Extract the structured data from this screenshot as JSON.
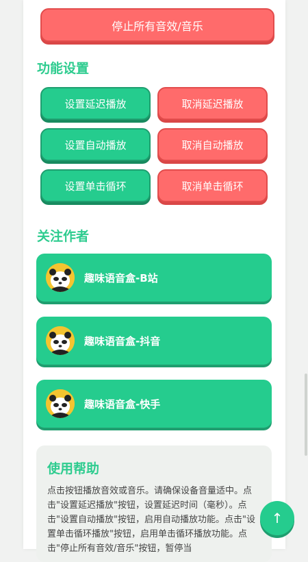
{
  "stop_button": "停止所有音效/音乐",
  "function_section": {
    "title": "功能设置",
    "buttons": [
      "设置延迟播放",
      "取消延迟播放",
      "设置自动播放",
      "取消自动播放",
      "设置单击循环",
      "取消单击循环"
    ]
  },
  "follow_section": {
    "title": "关注作者",
    "authors": [
      {
        "name": "趣味语音盒-B站",
        "icon": "panda-avatar"
      },
      {
        "name": "趣味语音盒-抖音",
        "icon": "panda-avatar"
      },
      {
        "name": "趣味语音盒-快手",
        "icon": "panda-avatar"
      }
    ]
  },
  "help": {
    "title": "使用帮助",
    "text": "点击按钮播放音效或音乐。请确保设备音量适中。点击\"设置延迟播放\"按钮，设置延迟时间（毫秒）。点击\"设置自动播放\"按钮，启用自动播放功能。点击\"设置单击循环播放\"按钮，启用单击循环播放功能。点击\"停止所有音效/音乐\"按钮，暂停当"
  },
  "fab": "↑",
  "colors": {
    "green": "#25cc8e",
    "red": "#ff6b6b",
    "title_green": "#2ecc8f"
  }
}
